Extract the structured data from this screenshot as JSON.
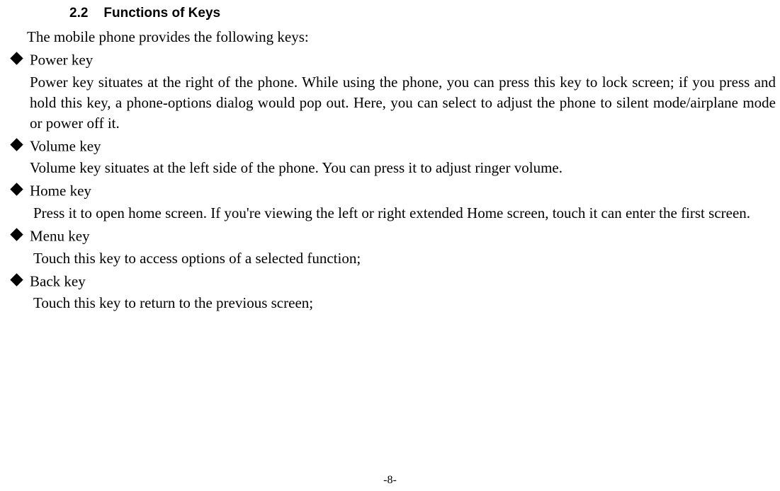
{
  "heading": {
    "number": "2.2",
    "title": "Functions of Keys"
  },
  "intro": "The mobile phone provides the following keys:",
  "items": [
    {
      "label": "Power key",
      "body": "Power key situates at the right of the phone. While using the phone, you can press this key to lock screen; if you press and hold this key, a phone-options dialog would pop out. Here, you can select to adjust the phone to silent mode/airplane mode or power off it.",
      "justify": true,
      "indent": false
    },
    {
      "label": "Volume key",
      "body": "Volume key situates at the left side of the phone. You can press it to adjust ringer volume.",
      "justify": false,
      "indent": false
    },
    {
      "label": "Home key",
      "body": "Press it to open home screen. If you're viewing the left or right extended Home screen, touch it can enter the first screen.",
      "justify": true,
      "indent": true
    },
    {
      "label": "Menu key",
      "body": "Touch this key to access options of a selected function;",
      "justify": false,
      "indent": true
    },
    {
      "label": "Back key",
      "body": "Touch this key to return to the previous screen;",
      "justify": false,
      "indent": true
    }
  ],
  "page_number": "-8-"
}
